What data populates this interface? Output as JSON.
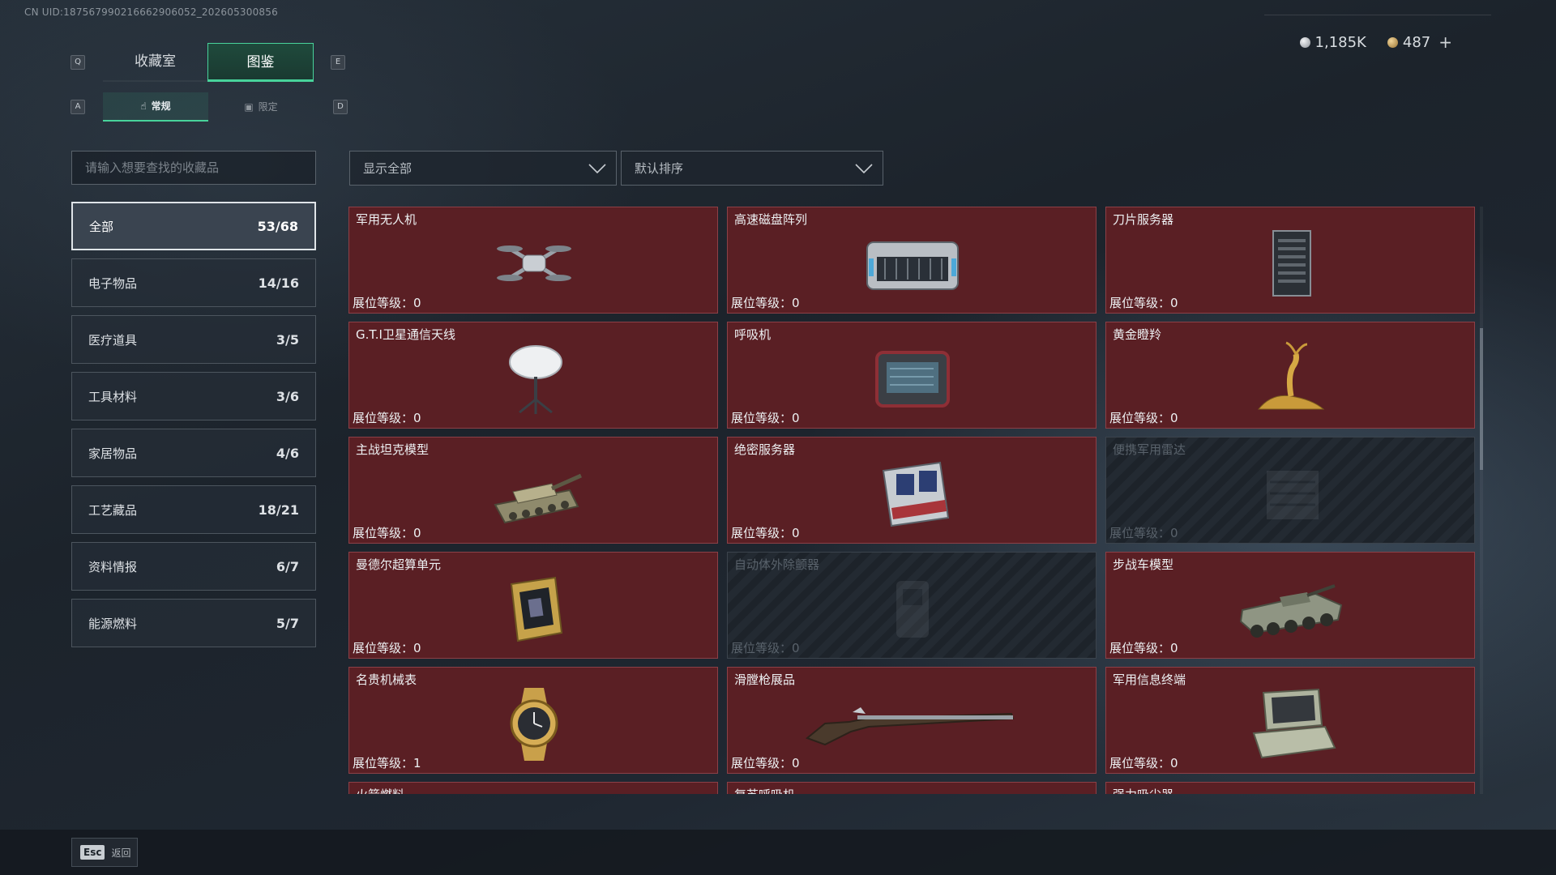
{
  "uid_label": "CN UID:187567990216662906052_202605300856",
  "top_tabs": [
    {
      "label": "收藏室",
      "key": "Q"
    },
    {
      "label": "图鉴",
      "key": "E"
    }
  ],
  "sub_tabs": [
    {
      "label": "常规",
      "key": "A"
    },
    {
      "label": "限定",
      "key": "D"
    }
  ],
  "currency": {
    "silver": "1,185K",
    "gold": "487",
    "plus": "+"
  },
  "search": {
    "placeholder": "请输入想要查找的收藏品"
  },
  "filters": {
    "show": "显示全部",
    "sort": "默认排序"
  },
  "categories": [
    {
      "label": "全部",
      "count": "53/68"
    },
    {
      "label": "电子物品",
      "count": "14/16"
    },
    {
      "label": "医疗道具",
      "count": "3/5"
    },
    {
      "label": "工具材料",
      "count": "3/6"
    },
    {
      "label": "家居物品",
      "count": "4/6"
    },
    {
      "label": "工艺藏品",
      "count": "18/21"
    },
    {
      "label": "资料情报",
      "count": "6/7"
    },
    {
      "label": "能源燃料",
      "count": "5/7"
    }
  ],
  "level_prefix": "展位等级：",
  "items": [
    {
      "name": "军用无人机",
      "level": "0",
      "icon": "drone-icon"
    },
    {
      "name": "高速磁盘阵列",
      "level": "0",
      "icon": "disk-array-icon"
    },
    {
      "name": "刀片服务器",
      "level": "0",
      "icon": "blade-server-icon"
    },
    {
      "name": "G.T.I卫星通信天线",
      "level": "0",
      "icon": "satellite-dish-icon"
    },
    {
      "name": "呼吸机",
      "level": "0",
      "icon": "ventilator-icon"
    },
    {
      "name": "黄金瞪羚",
      "level": "0",
      "icon": "golden-gazelle-icon"
    },
    {
      "name": "主战坦克模型",
      "level": "0",
      "icon": "tank-model-icon"
    },
    {
      "name": "绝密服务器",
      "level": "0",
      "icon": "secret-server-icon"
    },
    {
      "name": "便携军用雷达",
      "level": "0",
      "icon": "radar-icon"
    },
    {
      "name": "曼德尔超算单元",
      "level": "0",
      "icon": "supercomputer-unit-icon"
    },
    {
      "name": "自动体外除颤器",
      "level": "0",
      "icon": "defibrillator-icon"
    },
    {
      "name": "步战车模型",
      "level": "0",
      "icon": "ifv-model-icon"
    },
    {
      "name": "名贵机械表",
      "level": "1",
      "icon": "watch-icon"
    },
    {
      "name": "滑膛枪展品",
      "level": "0",
      "icon": "musket-icon"
    },
    {
      "name": "军用信息终端",
      "level": "0",
      "icon": "terminal-icon"
    },
    {
      "name": "火箭燃料",
      "level": "",
      "icon": "rocket-fuel-icon"
    },
    {
      "name": "复苏呼吸机",
      "level": "",
      "icon": "resuscitator-icon"
    },
    {
      "name": "强力吸尘器",
      "level": "",
      "icon": "vacuum-icon"
    }
  ],
  "esc": {
    "key": "Esc",
    "label": "返回"
  },
  "colors": {
    "accent": "#48d39b",
    "owned_card": "#5a1f24",
    "locked_card": "#232a32"
  }
}
